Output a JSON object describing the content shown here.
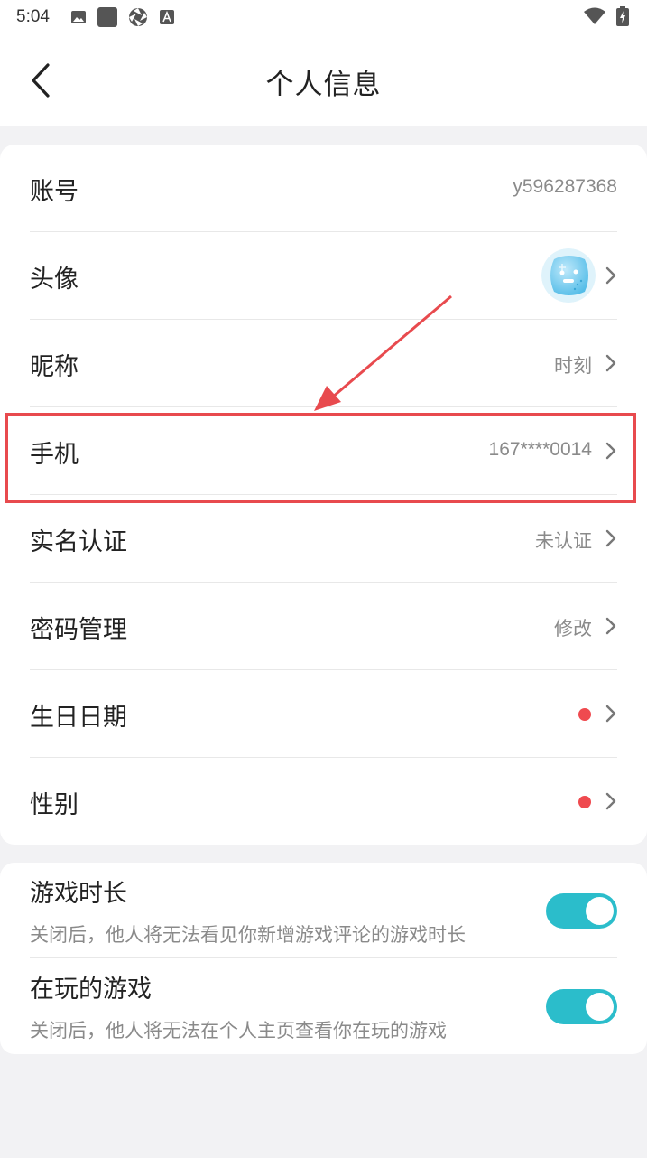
{
  "status_bar": {
    "time": "5:04",
    "left_icons": [
      "image-icon",
      "square-icon",
      "aperture-icon",
      "font-a-icon"
    ],
    "right_icons": [
      "wifi-icon",
      "battery-icon"
    ]
  },
  "header": {
    "title": "个人信息",
    "back_icon": "chevron-left-icon"
  },
  "profile_rows": [
    {
      "label": "账号",
      "value": "y596287368"
    },
    {
      "label": "头像",
      "value": ""
    },
    {
      "label": "昵称",
      "value": "时刻"
    },
    {
      "label": "手机",
      "value": "167****0014"
    },
    {
      "label": "实名认证",
      "value": "未认证"
    },
    {
      "label": "密码管理",
      "value": "修改"
    },
    {
      "label": "生日日期",
      "value": ""
    },
    {
      "label": "性别",
      "value": ""
    }
  ],
  "toggle_rows": [
    {
      "title": "游戏时长",
      "desc": "关闭后，他人将无法看见你新增游戏评论的游戏时长",
      "on": true
    },
    {
      "title": "在玩的游戏",
      "desc": "关闭后，他人将无法在个人主页查看你在玩的游戏",
      "on": true
    }
  ],
  "colors": {
    "toggle_on": "#2bbdcb",
    "red_dot": "#ef4a4f",
    "highlight": "#e84a4e",
    "background": "#f2f2f4"
  }
}
